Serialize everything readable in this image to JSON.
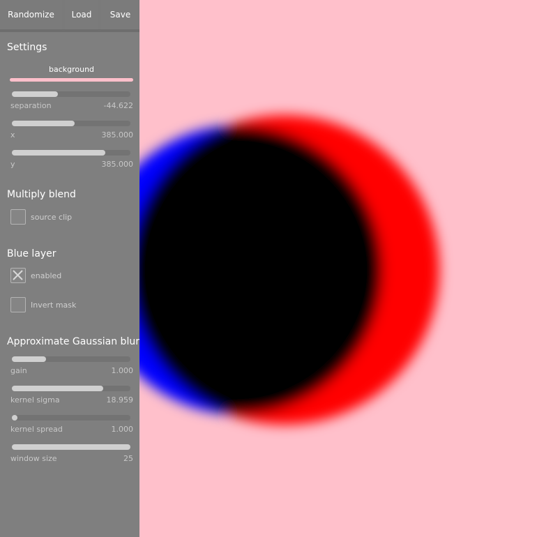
{
  "toolbar": {
    "randomize_label": "Randomize",
    "load_label": "Load",
    "save_label": "Save"
  },
  "settings": {
    "title": "Settings",
    "background": {
      "label": "background",
      "color": "#ffc0cb"
    },
    "separation": {
      "label": "separation",
      "value": "-44.622",
      "fraction": 0.39
    },
    "x": {
      "label": "x",
      "value": "385.000",
      "fraction": 0.53
    },
    "y": {
      "label": "y",
      "value": "385.000",
      "fraction": 0.79
    }
  },
  "multiply_blend": {
    "title": "Multiply blend",
    "source_clip": {
      "label": "source clip",
      "checked": false
    }
  },
  "blue_layer": {
    "title": "Blue layer",
    "enabled": {
      "label": "enabled",
      "checked": true
    },
    "invert_mask": {
      "label": "Invert mask",
      "checked": false
    }
  },
  "blur": {
    "title": "Approximate Gaussian blur",
    "gain": {
      "label": "gain",
      "value": "1.000",
      "fraction": 0.29
    },
    "kernel_sigma": {
      "label": "kernel sigma",
      "value": "18.959",
      "fraction": 0.77
    },
    "kernel_spread": {
      "label": "kernel spread",
      "value": "1.000",
      "fraction": 0.03
    },
    "window_size": {
      "label": "window size",
      "value": "25",
      "fraction": 1.0
    }
  },
  "canvas": {
    "background": "#ffc0cb",
    "blue_color": "#0000ff",
    "red_color": "#ff0000",
    "overlap_color": "#000000"
  }
}
